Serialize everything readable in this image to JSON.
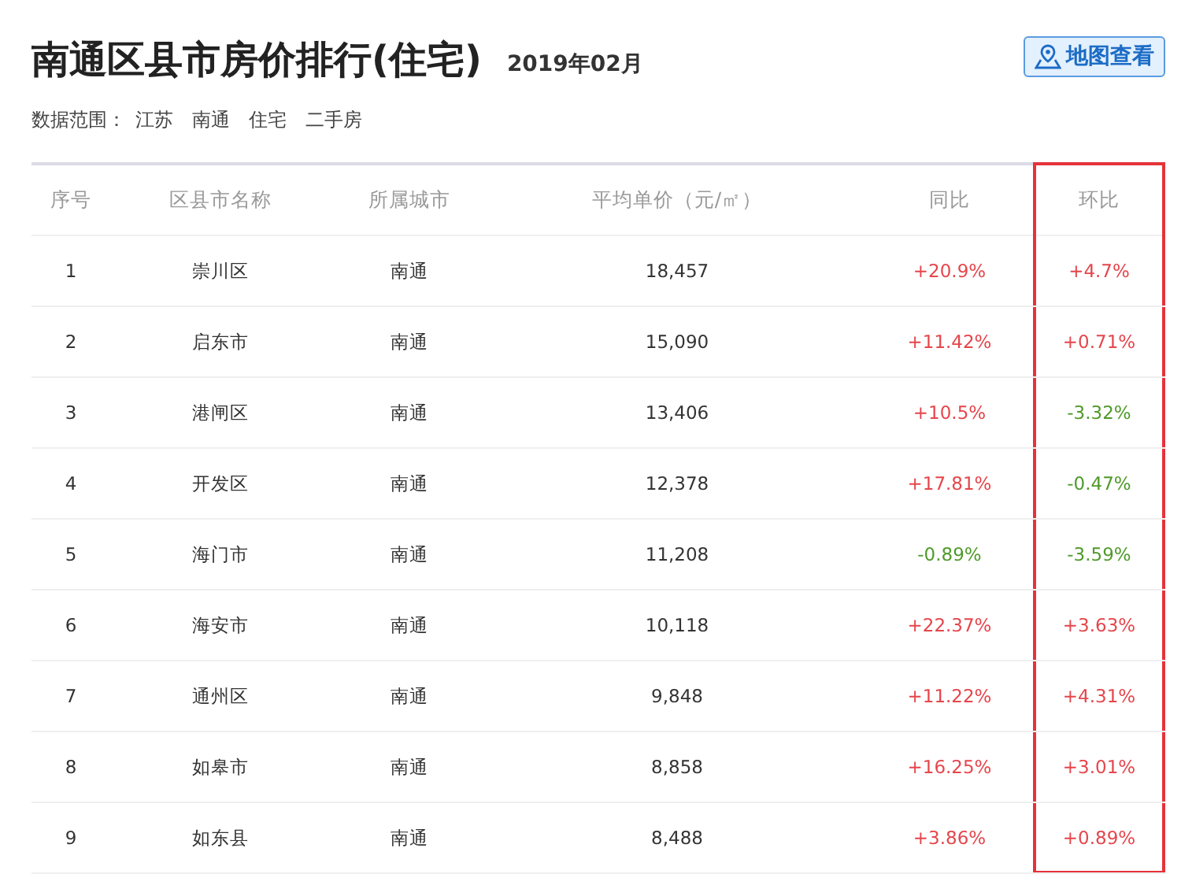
{
  "title": "南通区县市房价排行(住宅)",
  "period": "2019年02月",
  "map_button": "地图查看",
  "scope": {
    "label": "数据范围：",
    "items": [
      "江苏",
      "南通",
      "住宅",
      "二手房"
    ]
  },
  "columns": [
    {
      "label": "序号",
      "highlighted": false
    },
    {
      "label": "区县市名称",
      "highlighted": false
    },
    {
      "label": "所属城市",
      "highlighted": false
    },
    {
      "label": "平均单价（元/㎡）",
      "highlighted": false
    },
    {
      "label": "同比",
      "highlighted": false
    },
    {
      "label": "环比",
      "highlighted": true
    }
  ],
  "rows": [
    {
      "rank": "1",
      "district": "崇川区",
      "city": "南通",
      "price": "18,457",
      "yoy": {
        "text": "+20.9%",
        "color": "#e5464c"
      },
      "mom": {
        "text": "+4.7%",
        "color": "#e5464c"
      }
    },
    {
      "rank": "2",
      "district": "启东市",
      "city": "南通",
      "price": "15,090",
      "yoy": {
        "text": "+11.42%",
        "color": "#e5464c"
      },
      "mom": {
        "text": "+0.71%",
        "color": "#e5464c"
      }
    },
    {
      "rank": "3",
      "district": "港闸区",
      "city": "南通",
      "price": "13,406",
      "yoy": {
        "text": "+10.5%",
        "color": "#e5464c"
      },
      "mom": {
        "text": "-3.32%",
        "color": "#4f9a2a"
      }
    },
    {
      "rank": "4",
      "district": "开发区",
      "city": "南通",
      "price": "12,378",
      "yoy": {
        "text": "+17.81%",
        "color": "#e5464c"
      },
      "mom": {
        "text": "-0.47%",
        "color": "#4f9a2a"
      }
    },
    {
      "rank": "5",
      "district": "海门市",
      "city": "南通",
      "price": "11,208",
      "yoy": {
        "text": "-0.89%",
        "color": "#4f9a2a"
      },
      "mom": {
        "text": "-3.59%",
        "color": "#4f9a2a"
      }
    },
    {
      "rank": "6",
      "district": "海安市",
      "city": "南通",
      "price": "10,118",
      "yoy": {
        "text": "+22.37%",
        "color": "#e5464c"
      },
      "mom": {
        "text": "+3.63%",
        "color": "#e5464c"
      }
    },
    {
      "rank": "7",
      "district": "通州区",
      "city": "南通",
      "price": "9,848",
      "yoy": {
        "text": "+11.22%",
        "color": "#e5464c"
      },
      "mom": {
        "text": "+4.31%",
        "color": "#e5464c"
      }
    },
    {
      "rank": "8",
      "district": "如皋市",
      "city": "南通",
      "price": "8,858",
      "yoy": {
        "text": "+16.25%",
        "color": "#e5464c"
      },
      "mom": {
        "text": "+3.01%",
        "color": "#e5464c"
      }
    },
    {
      "rank": "9",
      "district": "如东县",
      "city": "南通",
      "price": "8,488",
      "yoy": {
        "text": "+3.86%",
        "color": "#e5464c"
      },
      "mom": {
        "text": "+0.89%",
        "color": "#e5464c"
      }
    }
  ]
}
